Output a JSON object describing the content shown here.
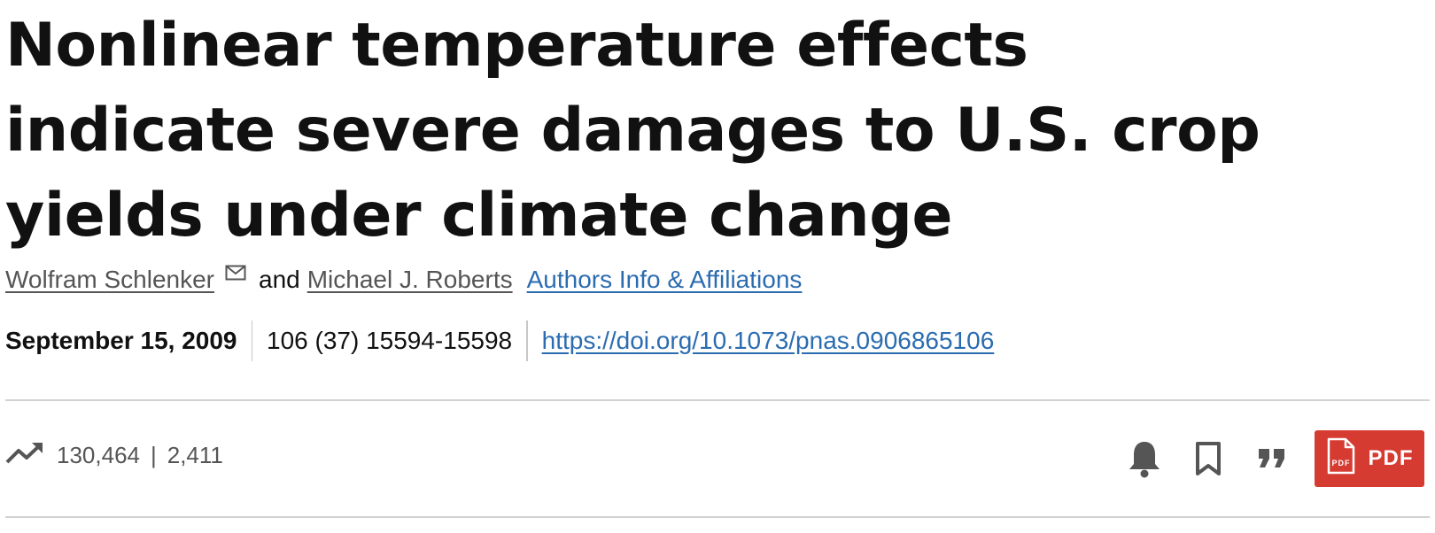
{
  "article": {
    "title": "Nonlinear temperature effects indicate severe damages to U.S. crop yields under climate change",
    "authors": [
      "Wolfram Schlenker",
      "Michael J. Roberts"
    ],
    "and_text": "and",
    "affiliations_label": "Authors Info & Affiliations",
    "date": "September 15, 2009",
    "citation": "106 (37) 15594-15598",
    "doi": "https://doi.org/10.1073/pnas.0906865106"
  },
  "metrics": {
    "views": "130,464",
    "separator": "|",
    "citations": "2,411"
  },
  "actions": {
    "pdf_label": "PDF",
    "pdf_icon_text": "PDF",
    "icons": [
      "trending-up-icon",
      "mail-icon",
      "bell-icon",
      "bookmark-icon",
      "quote-icon",
      "pdf-file-icon"
    ]
  },
  "colors": {
    "link": "#2b6cb0",
    "pdf_button": "#d63b32",
    "muted_text": "#555555",
    "divider": "#d2d2d2"
  }
}
